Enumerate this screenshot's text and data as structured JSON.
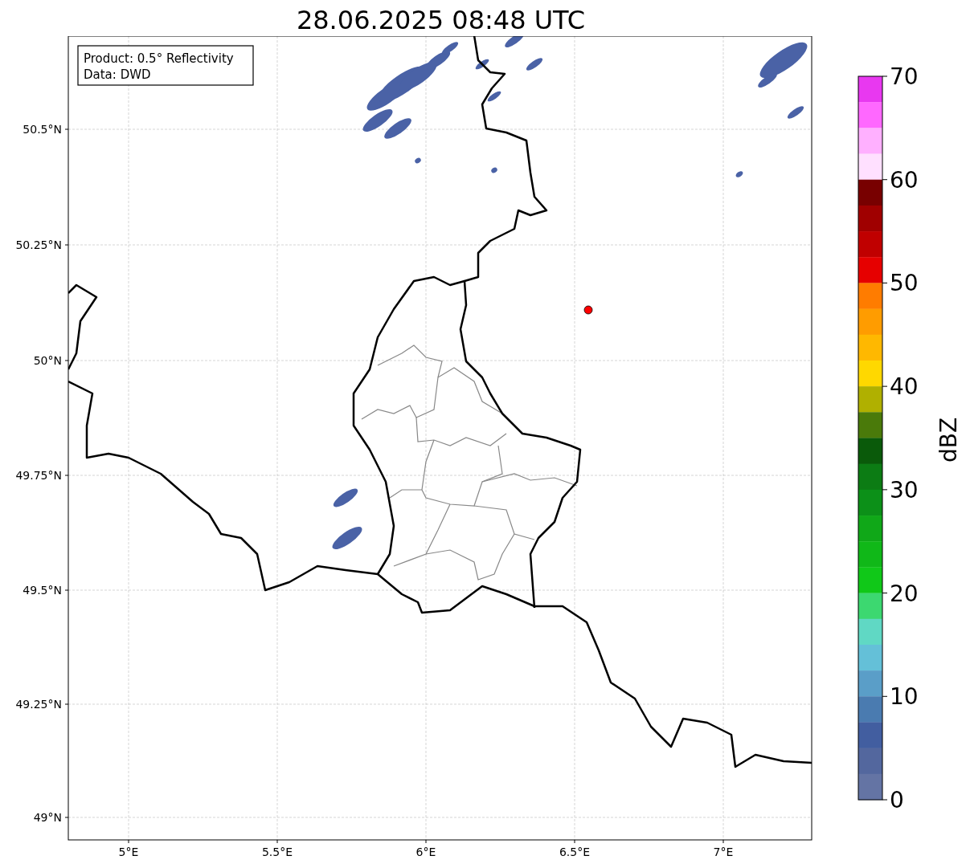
{
  "title": "28.06.2025 08:48 UTC",
  "info_box": {
    "lines": [
      "Product: 0.5° Reflectivity",
      "Data: DWD"
    ]
  },
  "map": {
    "yticks": [
      "50.5°N",
      "50.25°N",
      "50°N",
      "49.75°N",
      "49.5°N",
      "49.25°N",
      "49°N"
    ],
    "xticks": [
      "5°E",
      "5.5°E",
      "6°E",
      "6.5°E",
      "7°E"
    ]
  },
  "colorbar": {
    "label": "dBZ",
    "ticks": [
      "70",
      "60",
      "50",
      "40",
      "30",
      "20",
      "10",
      "0"
    ],
    "bands": [
      {
        "color": "#e838f0"
      },
      {
        "color": "#ff68ff"
      },
      {
        "color": "#ffb0ff"
      },
      {
        "color": "#ffe0ff"
      },
      {
        "color": "#780000"
      },
      {
        "color": "#a00000"
      },
      {
        "color": "#c00000"
      },
      {
        "color": "#e60000"
      },
      {
        "color": "#ff7c00"
      },
      {
        "color": "#ff9c00"
      },
      {
        "color": "#ffb800"
      },
      {
        "color": "#ffd800"
      },
      {
        "color": "#b0b000"
      },
      {
        "color": "#4a7a0a"
      },
      {
        "color": "#0a5a0a"
      },
      {
        "color": "#0c7c14"
      },
      {
        "color": "#0c9018"
      },
      {
        "color": "#10a818"
      },
      {
        "color": "#10b818"
      },
      {
        "color": "#10c818"
      },
      {
        "color": "#3cd870"
      },
      {
        "color": "#60d8c4"
      },
      {
        "color": "#64c0d8"
      },
      {
        "color": "#5a9ec8"
      },
      {
        "color": "#4a7bb0"
      },
      {
        "color": "#425ea0"
      },
      {
        "color": "#53679e"
      },
      {
        "color": "#6474a4"
      }
    ]
  }
}
